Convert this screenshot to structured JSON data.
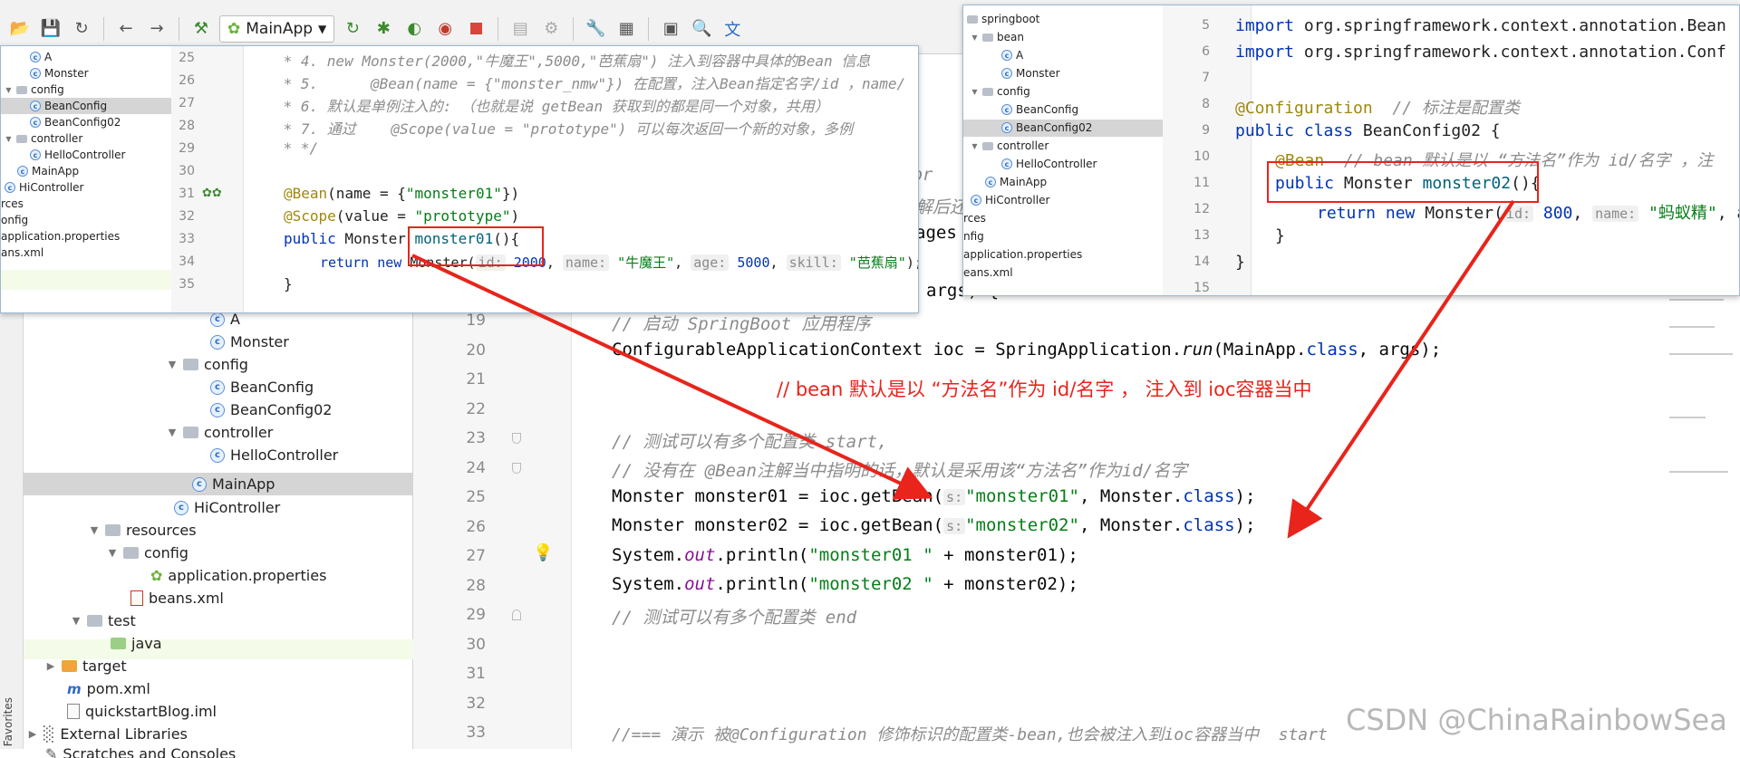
{
  "toolbar": {
    "run_config": "MainApp",
    "icons": [
      "open-icon",
      "save-icon",
      "sync-icon",
      "back-icon",
      "forward-icon",
      "build-icon",
      "run-icon",
      "debug-icon",
      "coverage-icon",
      "profile-icon",
      "stop-icon",
      "settings-icon",
      "structure-icon",
      "terminal-icon",
      "translate-icon"
    ]
  },
  "sidebar": {
    "favorites": "Favorites"
  },
  "project_tree": {
    "items": [
      {
        "label": "A",
        "icon": "class"
      },
      {
        "label": "Monster",
        "icon": "class"
      },
      {
        "label": "config",
        "icon": "folder"
      },
      {
        "label": "BeanConfig",
        "icon": "class"
      },
      {
        "label": "BeanConfig02",
        "icon": "class"
      },
      {
        "label": "controller",
        "icon": "folder"
      },
      {
        "label": "HelloController",
        "icon": "class"
      },
      {
        "label": "MainApp",
        "icon": "class"
      },
      {
        "label": "HiController",
        "icon": "class"
      },
      {
        "label": "resources",
        "icon": "folder"
      },
      {
        "label": "config",
        "icon": "folder"
      },
      {
        "label": "application.properties",
        "icon": "properties"
      },
      {
        "label": "beans.xml",
        "icon": "xml"
      },
      {
        "label": "test",
        "icon": "folder"
      },
      {
        "label": "java",
        "icon": "folder"
      },
      {
        "label": "target",
        "icon": "folder"
      },
      {
        "label": "pom.xml",
        "icon": "maven"
      },
      {
        "label": "quickstartBlog.iml",
        "icon": "file"
      },
      {
        "label": "External Libraries",
        "icon": "library"
      },
      {
        "label": "Scratches and Consoles",
        "icon": "scratch"
      }
    ]
  },
  "editor": {
    "line_numbers": [
      "19",
      "20",
      "21",
      "22",
      "23",
      "24",
      "25",
      "26",
      "27",
      "28",
      "29",
      "30",
      "31",
      "32",
      "33"
    ],
    "partial_top": {
      "a": "spr",
      "b": "解后还",
      "c": "ages",
      "d": "args) {"
    },
    "lines": {
      "l19": "// 启动 SpringBoot 应用程序",
      "l20_a": "ConfigurableApplicationContext ioc = SpringApplication.",
      "l20_b": "run",
      "l20_c": "(MainApp.",
      "l20_d": "class",
      "l20_e": ", args);",
      "l23": "// 测试可以有多个配置类 start,",
      "l24": "// 没有在 @Bean注解当中指明的话，默认是采用该“方法名”作为id/名字",
      "l25_a": "Monster monster01 = ioc.getBean(",
      "l25_hint": "s:",
      "l25_str": "\"monster01\"",
      "l25_b": ", Monster.",
      "l25_kw": "class",
      "l25_c": ");",
      "l26_a": "Monster monster02 = ioc.getBean(",
      "l26_hint": "s:",
      "l26_str": "\"monster02\"",
      "l26_b": ", Monster.",
      "l26_kw": "class",
      "l26_c": ");",
      "l27_a": "System.",
      "l27_out": "out",
      "l27_b": ".println(",
      "l27_str": "\"monster01 \"",
      "l27_c": " + monster01);",
      "l28_a": "System.",
      "l28_out": "out",
      "l28_b": ".println(",
      "l28_str": "\"monster02 \"",
      "l28_c": " + monster02);",
      "l29": "// 测试可以有多个配置类 end",
      "l33": "//=== 演示 被@Configuration 修饰标识的配置类-bean,也会被注入到ioc容器当中  start"
    }
  },
  "annotation_note": "// bean 默认是以 “方法名”作为 id/名字 ， 注入到 ioc容器当中",
  "watermark": "CSDN @ChinaRainbowSea",
  "popup_left": {
    "tree": [
      {
        "label": "A",
        "icon": "class"
      },
      {
        "label": "Monster",
        "icon": "class"
      },
      {
        "label": "config",
        "icon": "folder"
      },
      {
        "label": "BeanConfig",
        "icon": "class"
      },
      {
        "label": "BeanConfig02",
        "icon": "class"
      },
      {
        "label": "controller",
        "icon": "folder"
      },
      {
        "label": "HelloController",
        "icon": "class"
      },
      {
        "label": "MainApp",
        "icon": "class"
      },
      {
        "label": "HiController",
        "icon": "class"
      },
      {
        "label": "rces",
        "icon": "none"
      },
      {
        "label": "onfig",
        "icon": "none"
      },
      {
        "label": "application.properties",
        "icon": "properties"
      },
      {
        "label": "ans.xml",
        "icon": "none"
      }
    ],
    "line_numbers": [
      "25",
      "26",
      "27",
      "28",
      "29",
      "30",
      "31",
      "32",
      "33",
      "34",
      "35"
    ],
    "lines": {
      "l25": " * 4. new Monster(2000,\"牛魔王\",5000,\"芭蕉扇\") 注入到容器中具体的Bean 信息",
      "l26": " * 5.      @Bean(name = {\"monster_nmw\"}) 在配置，注入Bean指定名字/id ，name∕",
      "l27": " * 6. 默认是单例注入的: （也就是说 getBean 获取到的都是同一个对象，共用）",
      "l28": " * 7. 通过    @Scope(value = \"prototype\") 可以每次返回一个新的对象，多例",
      "l29": " * */",
      "l31_a": "@Bean",
      "l31_b": "(name = {",
      "l31_str": "\"monster01\"",
      "l31_c": "})",
      "l32_a": "@Scope",
      "l32_b": "(value = ",
      "l32_str": "\"prototype\"",
      "l32_c": ")",
      "l33_kw": "public",
      "l33_a": " Monster ",
      "l33_m": "monster01",
      "l33_b": "(){",
      "l34_kw": "return new",
      "l34_a": " Monster(",
      "l34_h1": "id:",
      "l34_n1": " 2000",
      "l34_s1": ", ",
      "l34_h2": "name:",
      "l34_str1": " \"牛魔王\"",
      "l34_s2": ", ",
      "l34_h3": "age:",
      "l34_n2": " 5000",
      "l34_s3": ", ",
      "l34_h4": "skill:",
      "l34_str2": " \"芭蕉扇\"",
      "l34_c": ");",
      "l35": "}"
    }
  },
  "popup_right": {
    "tree": [
      {
        "label": "springboot",
        "icon": "folder"
      },
      {
        "label": "bean",
        "icon": "folder"
      },
      {
        "label": "A",
        "icon": "class"
      },
      {
        "label": "Monster",
        "icon": "class"
      },
      {
        "label": "config",
        "icon": "folder"
      },
      {
        "label": "BeanConfig",
        "icon": "class"
      },
      {
        "label": "BeanConfig02",
        "icon": "class"
      },
      {
        "label": "controller",
        "icon": "folder"
      },
      {
        "label": "HelloController",
        "icon": "class"
      },
      {
        "label": "MainApp",
        "icon": "class"
      },
      {
        "label": "HiController",
        "icon": "class"
      },
      {
        "label": "rces",
        "icon": "none"
      },
      {
        "label": "nfig",
        "icon": "none"
      },
      {
        "label": "application.properties",
        "icon": "properties"
      },
      {
        "label": "eans.xml",
        "icon": "none"
      }
    ],
    "line_numbers": [
      "5",
      "6",
      "7",
      "8",
      "9",
      "10",
      "11",
      "12",
      "13",
      "14",
      "15"
    ],
    "lines": {
      "l5_kw": "import",
      "l5_a": " org.springframework.context.annotation.Bean",
      "l6_kw": "import",
      "l6_a": " org.springframework.context.annotation.Conf",
      "l8_a": "@Configuration",
      "l8_c": "  // 标注是配置类",
      "l9_kw": "public class",
      "l9_a": " BeanConfig02 {",
      "l10_a": "@Bean",
      "l10_c": "  // bean 默认是以 “方法名”作为 id/名字 ，注",
      "l11_kw": "public",
      "l11_a": " Monster ",
      "l11_m": "monster02",
      "l11_b": "(){",
      "l12_kw": "return new",
      "l12_a": " Monster(",
      "l12_h1": "id:",
      "l12_n1": " 800",
      "l12_s1": ", ",
      "l12_h2": "name:",
      "l12_str": " \"蚂蚁精\"",
      "l12_s2": ", a",
      "l13": "}",
      "l14": "}"
    }
  },
  "colors": {
    "arrow": "#e8241b",
    "keyword": "#0033b3",
    "string": "#067d17",
    "comment": "#8c8c8c",
    "annotation": "#9e880d"
  }
}
